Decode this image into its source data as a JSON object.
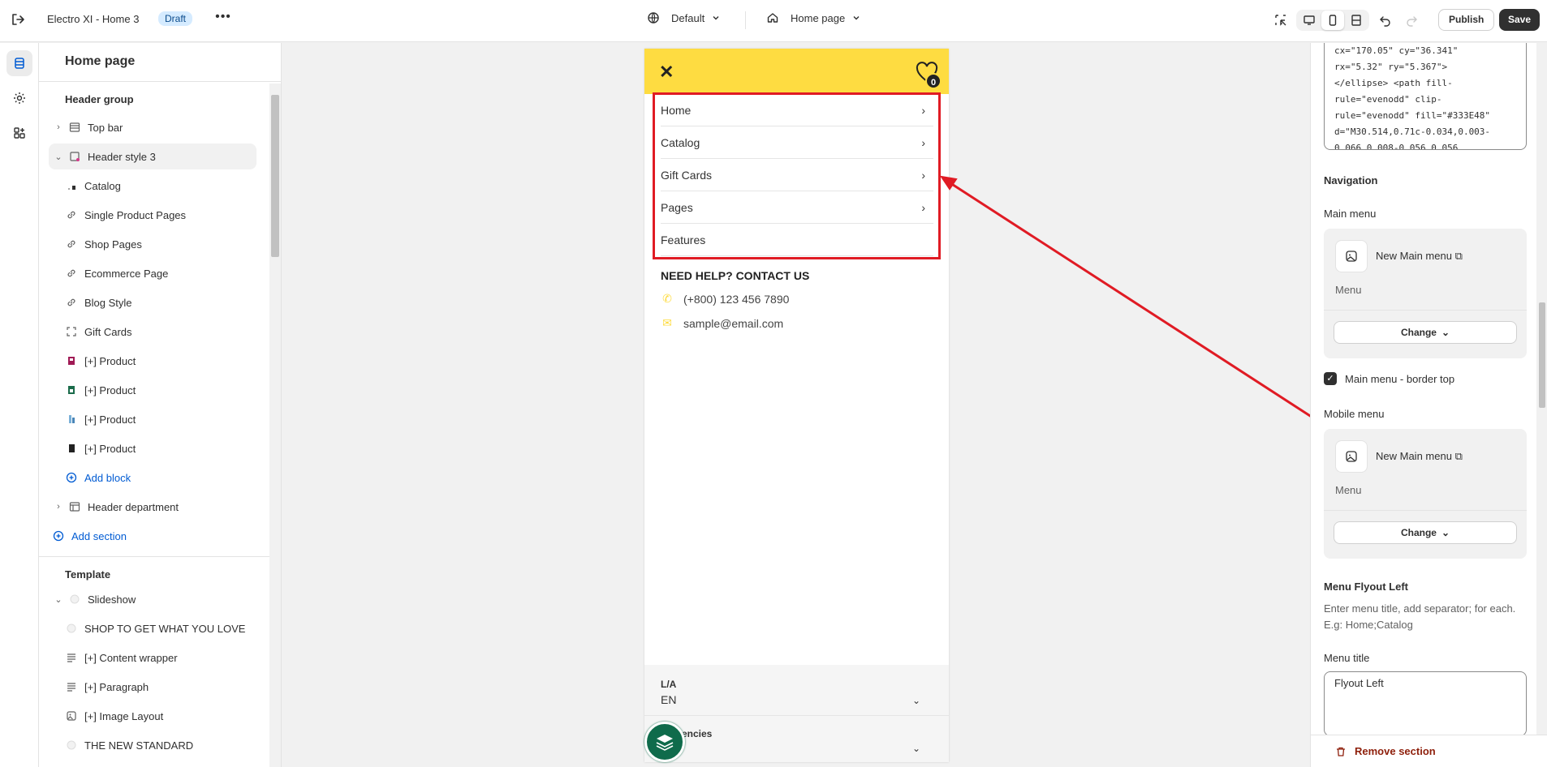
{
  "topbar": {
    "store_title": "Electro XI - Home 3",
    "badge": "Draft",
    "more": "•••",
    "theme_select": "Default",
    "page_select": "Home page",
    "publish": "Publish",
    "save": "Save"
  },
  "sidebar": {
    "title": "Home page",
    "header_group_label": "Header group",
    "header_items": [
      {
        "label": "Top bar",
        "icon": "layout-icon"
      },
      {
        "label": "Header style 3",
        "icon": "section-icon"
      },
      {
        "label": "Catalog",
        "icon": "image-icon"
      },
      {
        "label": "Single Product Pages",
        "icon": "link-icon"
      },
      {
        "label": "Shop Pages",
        "icon": "link-icon"
      },
      {
        "label": "Ecommerce Page",
        "icon": "link-icon"
      },
      {
        "label": "Blog Style",
        "icon": "link-icon"
      },
      {
        "label": "Gift Cards",
        "icon": "frame-icon"
      },
      {
        "label": "[+] Product",
        "icon": "product-icon"
      },
      {
        "label": "[+] Product",
        "icon": "product-icon"
      },
      {
        "label": "[+] Product",
        "icon": "product-icon"
      },
      {
        "label": "[+] Product",
        "icon": "product-icon"
      },
      {
        "label": "Add block",
        "icon": "plus-circle-icon"
      },
      {
        "label": "Header department",
        "icon": "layout-icon"
      },
      {
        "label": "Add section",
        "icon": "plus-circle-icon"
      }
    ],
    "template_label": "Template",
    "template_items": [
      {
        "label": "Slideshow",
        "icon": "image-icon"
      },
      {
        "label": "SHOP TO GET WHAT YOU LOVE",
        "icon": "image-icon"
      },
      {
        "label": "[+] Content wrapper",
        "icon": "text-icon"
      },
      {
        "label": "[+] Paragraph",
        "icon": "text-icon"
      },
      {
        "label": "[+] Image Layout",
        "icon": "image-icon"
      },
      {
        "label": "THE NEW STANDARD",
        "icon": "image-icon"
      }
    ]
  },
  "preview": {
    "cart_count": "0",
    "nav": [
      {
        "label": "Home",
        "has_arrow": true
      },
      {
        "label": "Catalog",
        "has_arrow": true
      },
      {
        "label": "Gift Cards",
        "has_arrow": true
      },
      {
        "label": "Pages",
        "has_arrow": true
      },
      {
        "label": "Features",
        "has_arrow": false
      }
    ],
    "help_title": "NEED HELP? CONTACT US",
    "phone": "(+800) 123 456 7890",
    "email": "sample@email.com",
    "lang_label": "L/A",
    "lang_value": "EN",
    "currency_label": "encies"
  },
  "panel": {
    "code_text": "cx=\"170.05\" cy=\"36.341\"\nrx=\"5.32\" ry=\"5.367\">\n</ellipse> <path fill-\nrule=\"evenodd\" clip-\nrule=\"evenodd\" fill=\"#333E48\"\nd=\"M30.514,0.71c-0.034,0.003-\n0.066,0.008-0.056,0.056",
    "navigation_heading": "Navigation",
    "main_menu_label": "Main menu",
    "main_menu_name": "New Main menu",
    "main_menu_sub": "Menu",
    "change": "Change",
    "border_top_label": "Main menu - border top",
    "mobile_menu_label": "Mobile menu",
    "mobile_menu_name": "New Main menu",
    "mobile_menu_sub": "Menu",
    "flyout_heading": "Menu Flyout Left",
    "flyout_help": "Enter menu title, add separator; for each. E.g: Home;Catalog",
    "menu_title_label": "Menu title",
    "menu_title_value": "Flyout Left",
    "remove_section": "Remove section"
  },
  "colors": {
    "accent_yellow": "#fedc41",
    "annotation_red": "#e01b24",
    "link_blue": "#005bd3",
    "save_dark": "#303030"
  }
}
